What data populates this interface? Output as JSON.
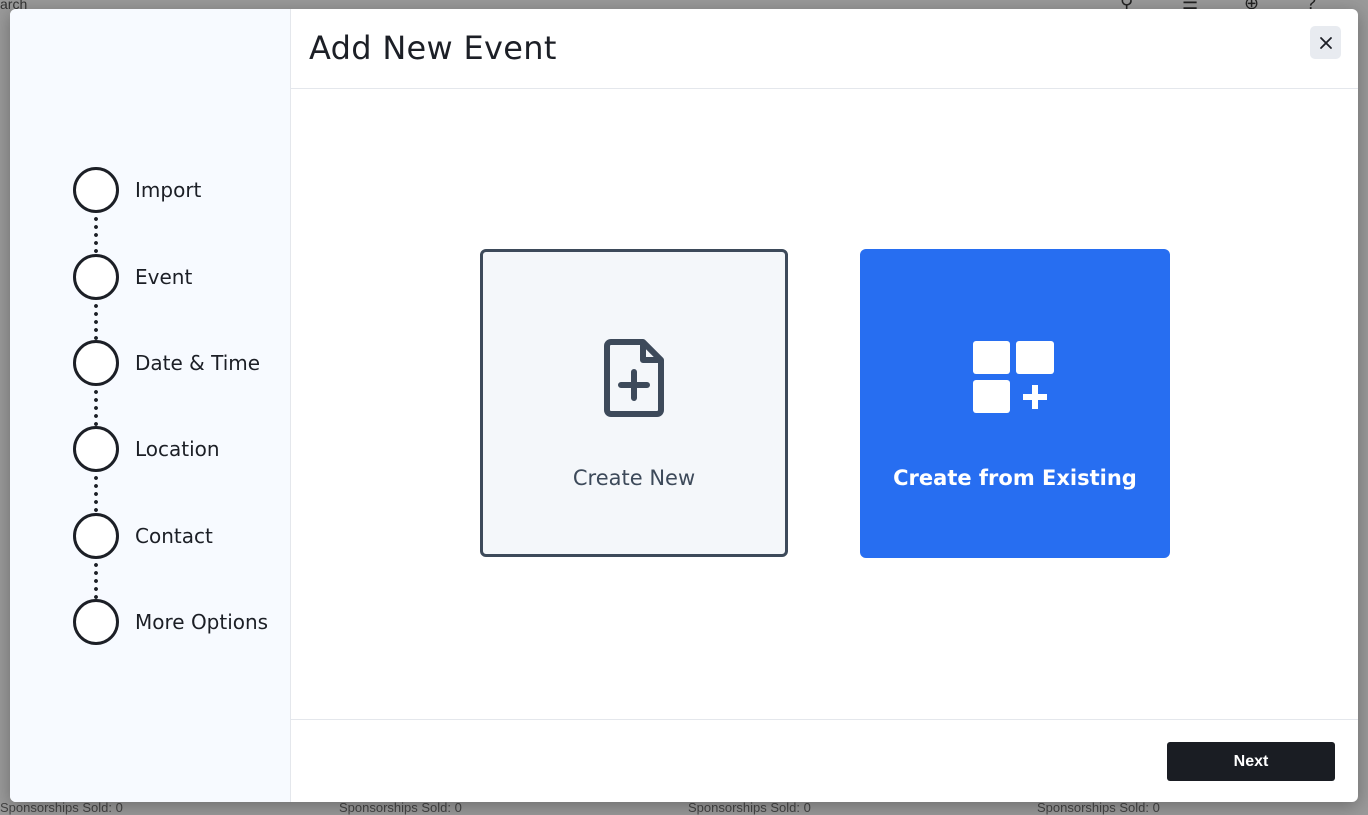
{
  "background": {
    "search_text": "arch",
    "footer_items": [
      "Sponsorships Sold: 0",
      "Sponsorships Sold: 0",
      "Sponsorships Sold: 0",
      "Sponsorships Sold: 0"
    ]
  },
  "modal": {
    "title": "Add New Event",
    "close_icon": "close-x-icon",
    "steps": [
      {
        "label": "Import"
      },
      {
        "label": "Event"
      },
      {
        "label": "Date & Time"
      },
      {
        "label": "Location"
      },
      {
        "label": "Contact"
      },
      {
        "label": "More Options"
      }
    ],
    "options": {
      "create_new": {
        "label": "Create New",
        "icon": "file-plus-icon"
      },
      "create_existing": {
        "label": "Create from Existing",
        "icon": "grid-plus-icon"
      }
    },
    "next_label": "Next"
  },
  "colors": {
    "primary_blue": "#276ef1",
    "dark": "#1a1d23",
    "card_border": "#3d4a5a",
    "sidebar_bg": "#f7faff"
  }
}
